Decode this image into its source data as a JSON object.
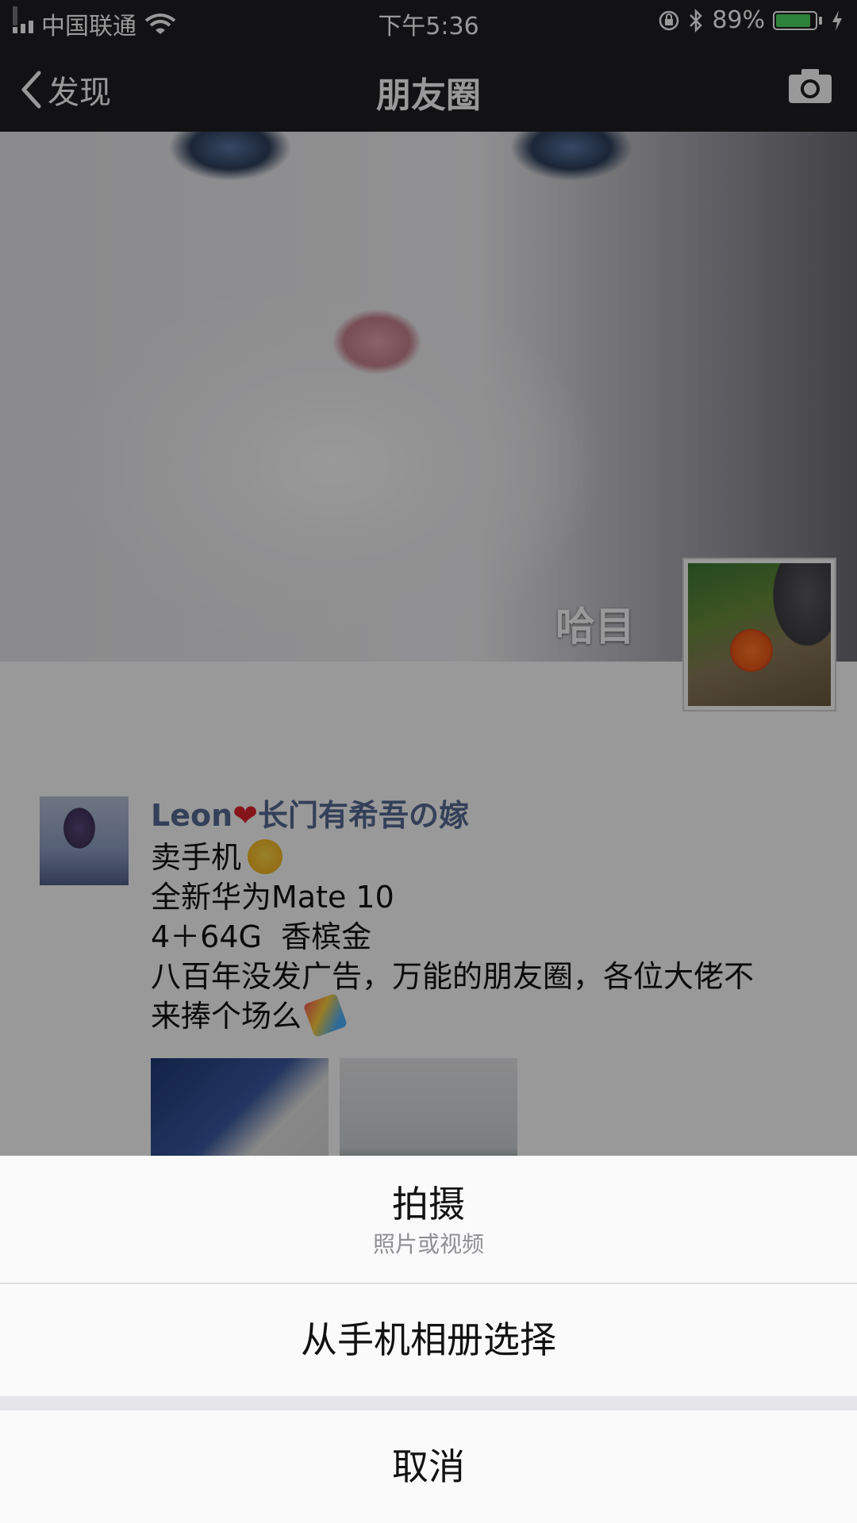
{
  "status_bar": {
    "carrier": "中国联通",
    "time": "下午5:36",
    "battery_percent": "89%",
    "battery_level": 0.89
  },
  "nav": {
    "back_label": "发现",
    "title": "朋友圈",
    "camera_icon": "camera-icon"
  },
  "profile": {
    "cover_name": "哈目"
  },
  "post": {
    "author": "Leon",
    "author_suffix": "长门有希吾の嫁",
    "lines": [
      "卖手机",
      "全新华为Mate 10",
      "4＋64G  香槟金",
      "八百年没发广告，万能的朋友圈，各位大佬不",
      "来捧个场么"
    ],
    "icons": [
      "heart-icon",
      "laughing-crying-emoji-icon",
      "party-popper-emoji-icon"
    ]
  },
  "action_sheet": {
    "shoot_label": "拍摄",
    "shoot_sub": "照片或视频",
    "album_label": "从手机相册选择",
    "cancel_label": "取消"
  },
  "colors": {
    "nav_bg": "#1f1f22",
    "name_link": "#576b95",
    "battery_green": "#4cd964",
    "sheet_bg": "#fafafa"
  }
}
